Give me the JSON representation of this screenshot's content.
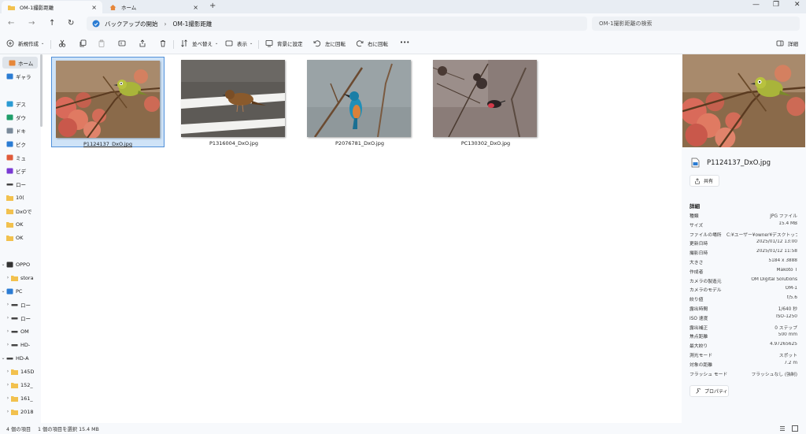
{
  "tabs": [
    {
      "label": "OM-1撮影距離",
      "active": true
    },
    {
      "label": "ホーム",
      "active": false
    }
  ],
  "window_controls": {
    "minimize": "—",
    "maximize": "❐",
    "close": "✕"
  },
  "address": {
    "segments": [
      "バックアップの開始",
      "OM-1撮影距離"
    ],
    "search_placeholder": "OM-1撮影距離の検索"
  },
  "toolbar": {
    "new": "新規作成",
    "sort": "並べ替え",
    "view": "表示",
    "set_background": "背景に設定",
    "rotate_left": "左に回転",
    "rotate_right": "右に回転",
    "more": "•••",
    "details": "詳細"
  },
  "sidebar": {
    "items": [
      {
        "label": "ホーム",
        "icon": "home-icon"
      },
      {
        "label": "ギャラ",
        "icon": "gallery-icon"
      },
      {
        "label": "デス",
        "icon": "desktop-icon"
      },
      {
        "label": "ダウ",
        "icon": "download-icon"
      },
      {
        "label": "ドキ",
        "icon": "document-icon"
      },
      {
        "label": "ピク",
        "icon": "pictures-icon"
      },
      {
        "label": "ミュ",
        "icon": "music-icon"
      },
      {
        "label": "ビデ",
        "icon": "video-icon"
      },
      {
        "label": "ロー",
        "icon": "drive-icon"
      },
      {
        "label": "10( ",
        "icon": "folder-icon"
      },
      {
        "label": "DxOで",
        "icon": "folder-icon"
      },
      {
        "label": "OK",
        "icon": "folder-icon"
      },
      {
        "label": "OK",
        "icon": "folder-icon"
      },
      {
        "label": "OPPO",
        "icon": "phone-icon"
      },
      {
        "label": "stora",
        "icon": "folder-icon"
      },
      {
        "label": "PC",
        "icon": "pc-icon"
      },
      {
        "label": "ロー",
        "icon": "drive-icon"
      },
      {
        "label": "ロー",
        "icon": "drive-icon"
      },
      {
        "label": "OM",
        "icon": "drive-icon"
      },
      {
        "label": "HD-",
        "icon": "drive-icon"
      },
      {
        "label": "HD-A",
        "icon": "drive-icon"
      },
      {
        "label": "145D",
        "icon": "folder-icon"
      },
      {
        "label": "152_",
        "icon": "folder-icon"
      },
      {
        "label": "161_",
        "icon": "folder-icon"
      },
      {
        "label": "2018",
        "icon": "folder-icon"
      }
    ]
  },
  "files": [
    {
      "name": "P1124137_DxO.jpg",
      "selected": true
    },
    {
      "name": "P1316004_DxO.jpg",
      "selected": false
    },
    {
      "name": "P2076781_DxO.jpg",
      "selected": false
    },
    {
      "name": "PC130302_DxO.jpg",
      "selected": false
    }
  ],
  "details_pane": {
    "file_name": "P1124137_DxO.jpg",
    "share": "共有",
    "section_title": "詳細",
    "properties": "プロパティ",
    "rows": [
      {
        "key": "種類",
        "value": "JPG ファイル"
      },
      {
        "key": "サイズ",
        "value": "15.4 MB"
      },
      {
        "key": "ファイルの場所",
        "value": "C:¥ユーザー¥owner¥デスクトップ¥..."
      },
      {
        "key": "更新日時",
        "value": "2025/01/12 13:00"
      },
      {
        "key": "撮影日時",
        "value": "2025/01/12 11:58"
      },
      {
        "key": "大きさ",
        "value": "5184 x 3888"
      },
      {
        "key": "作成者",
        "value": "Makoto T"
      },
      {
        "key": "カメラの製造元",
        "value": "OM Digital Solutions"
      },
      {
        "key": "カメラのモデル",
        "value": "OM-1"
      },
      {
        "key": "絞り値",
        "value": "f/5.6"
      },
      {
        "key": "露出時間",
        "value": "1/640 秒"
      },
      {
        "key": "ISO 速度",
        "value": "ISO-1250"
      },
      {
        "key": "露出補正",
        "value": "0 ステップ"
      },
      {
        "key": "焦点距離",
        "value": "500 mm"
      },
      {
        "key": "最大絞り",
        "value": "4.97265625"
      },
      {
        "key": "測光モード",
        "value": "スポット"
      },
      {
        "key": "対象の距離",
        "value": "7.2 m"
      },
      {
        "key": "フラッシュ モード",
        "value": "フラッシュなし (強制)"
      }
    ]
  },
  "status": {
    "count": "4 個の項目",
    "selection": "1 個の項目を選択 15.4 MB"
  },
  "colors": {
    "accent": "#0067c0",
    "selection_bg": "#cfe3f7",
    "selection_border": "#4f8fd8",
    "folder": "#f2c14e"
  }
}
